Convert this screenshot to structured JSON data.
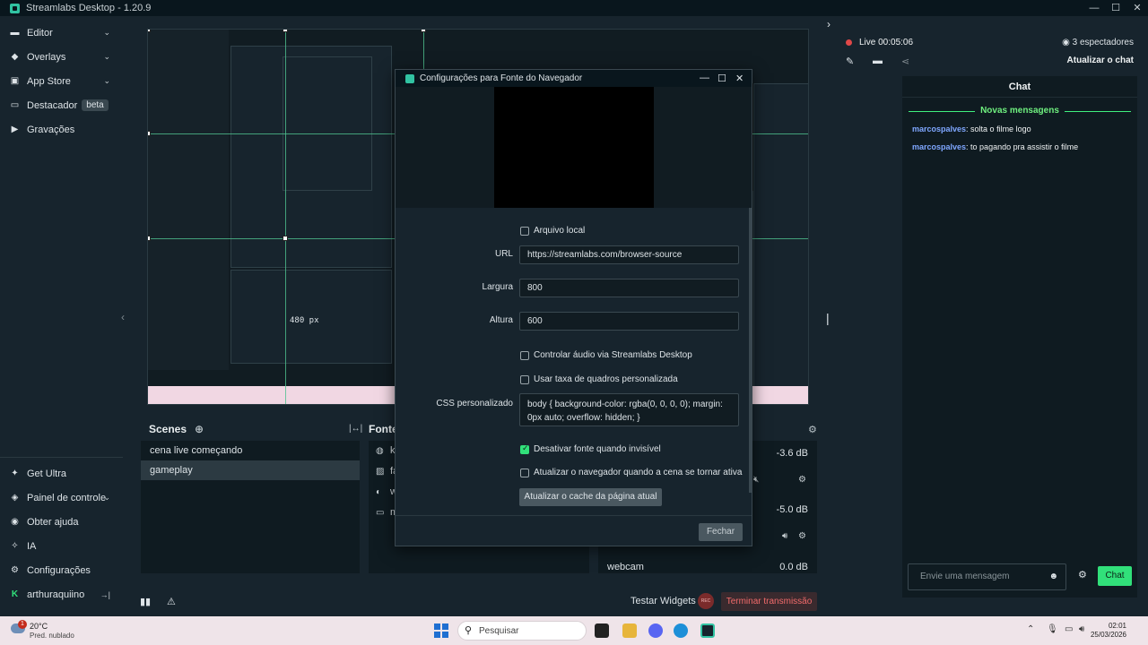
{
  "app": {
    "title": "Streamlabs Desktop - 1.20.9",
    "win_min": "—",
    "win_max": "☐",
    "win_close": "✕"
  },
  "sidebar": {
    "items": [
      {
        "label": "Editor",
        "icon": "editor-icon"
      },
      {
        "label": "Overlays",
        "icon": "overlays-icon"
      },
      {
        "label": "App Store",
        "icon": "app-store-icon"
      },
      {
        "label": "Destacador",
        "badge": "beta",
        "icon": "highlighter-icon"
      },
      {
        "label": "Gravações",
        "icon": "recordings-icon"
      }
    ],
    "bottom": [
      {
        "label": "Get Ultra",
        "icon": "ultra-icon"
      },
      {
        "label": "Painel de controle",
        "icon": "dashboard-icon"
      },
      {
        "label": "Obter ajuda",
        "icon": "help-icon"
      },
      {
        "label": "IA",
        "icon": "ai-icon"
      },
      {
        "label": "Configurações",
        "icon": "settings-icon"
      },
      {
        "label": "arthuraquiino",
        "icon": "kick-icon"
      }
    ]
  },
  "preview": {
    "size_label": "480 px"
  },
  "scenes": {
    "title": "Scenes",
    "items": [
      "cena live começando",
      "gameplay"
    ],
    "active_index": 1
  },
  "sources": {
    "title": "Fonte",
    "items": [
      {
        "label": "ki",
        "icon": "globe-icon"
      },
      {
        "label": "fa",
        "icon": "image-icon"
      },
      {
        "label": "w",
        "icon": "webcam-icon"
      },
      {
        "label": "m",
        "icon": "monitor-icon"
      }
    ]
  },
  "mixer": {
    "rows": [
      {
        "label": "",
        "db": "-3.6 dB"
      },
      {
        "label": "",
        "db": "-5.0 dB"
      },
      {
        "label": "webcam",
        "db": "0.0 dB"
      }
    ]
  },
  "statusbar": {
    "test_widgets": "Testar Widgets",
    "rec": "REC",
    "end_stream": "Terminar transmissão"
  },
  "live": {
    "status": "Live 00:05:06",
    "viewers": "3 espectadores",
    "refresh_chat": "Atualizar o chat"
  },
  "chat": {
    "title": "Chat",
    "new_messages": "Novas mensagens",
    "messages": [
      {
        "user": "marcospalves",
        "text": ": solta o filme logo"
      },
      {
        "user": "marcospalves",
        "text": ": to pagando pra assistir o filme"
      }
    ],
    "input_placeholder": "Envie uma mensagem",
    "send_label": "Chat",
    "accent_color": "#31e07a"
  },
  "dialog": {
    "title": "Configurações para Fonte do Navegador",
    "local_file_label": "Arquivo local",
    "local_file_checked": false,
    "url_label": "URL",
    "url_value": "https://streamlabs.com/browser-source",
    "width_label": "Largura",
    "width_value": "800",
    "height_label": "Altura",
    "height_value": "600",
    "audio_label": "Controlar áudio via Streamlabs Desktop",
    "audio_checked": false,
    "fps_label": "Usar taxa de quadros personalizada",
    "fps_checked": false,
    "css_label": "CSS personalizado",
    "css_value": "body { background-color: rgba(0, 0, 0, 0); margin: 0px auto; overflow: hidden; }",
    "shutdown_label": "Desativar fonte quando invisível",
    "shutdown_checked": true,
    "refresh_label": "Atualizar o navegador quando a cena se tornar ativa",
    "refresh_checked": false,
    "cache_button": "Atualizar o cache da página atual",
    "close_button": "Fechar"
  },
  "taskbar": {
    "weather_temp": "20°C",
    "weather_desc": "Pred. nublado",
    "weather_badge": "1",
    "search_placeholder": "Pesquisar",
    "time": "02:01",
    "date": "25/03/2026"
  }
}
